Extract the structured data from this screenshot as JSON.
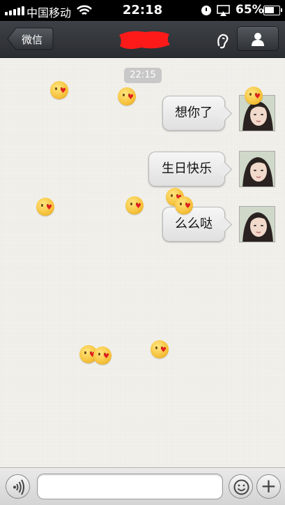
{
  "status_bar": {
    "carrier": "中国移动",
    "time": "22:18",
    "battery_percent": "65%"
  },
  "nav": {
    "back_label": "微信",
    "title": ""
  },
  "chat": {
    "timestamp": "22:15",
    "messages": [
      {
        "text": "想你了",
        "sender": "me"
      },
      {
        "text": "生日快乐",
        "sender": "me"
      },
      {
        "text": "么么哒",
        "sender": "me"
      }
    ]
  },
  "input": {
    "value": "",
    "plus_label": "+"
  },
  "icons": [
    "signal-icon",
    "wifi-icon",
    "alarm-icon",
    "airplay-icon",
    "battery-icon",
    "back-chevron-icon",
    "earpiece-icon",
    "profile-icon",
    "voice-icon",
    "emoji-icon",
    "plus-icon",
    "kiss-emoji-icon"
  ],
  "colors": {
    "nav_bg": "#33373b",
    "chat_bg": "#f2f1ec",
    "redaction": "#ff1a1a"
  }
}
